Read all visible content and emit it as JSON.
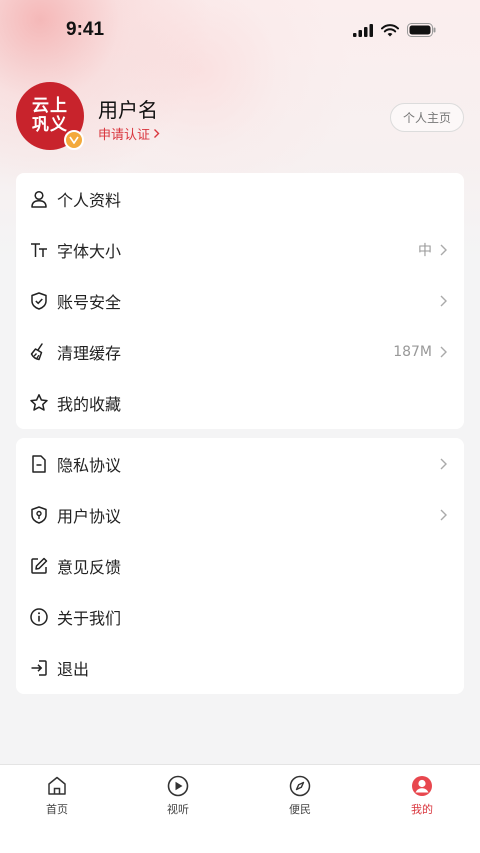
{
  "status_bar": {
    "time": "9:41"
  },
  "profile": {
    "avatar_text": "云上\n巩义",
    "username": "用户名",
    "verify_label": "申请认证",
    "homepage_button": "个人主页"
  },
  "menu_group_1": [
    {
      "label": "个人资料",
      "icon": "person-icon",
      "value": "",
      "chevron": false
    },
    {
      "label": "字体大小",
      "icon": "font-size-icon",
      "value": "中",
      "chevron": true
    },
    {
      "label": "账号安全",
      "icon": "shield-check-icon",
      "value": "",
      "chevron": true
    },
    {
      "label": "清理缓存",
      "icon": "broom-icon",
      "value": "187M",
      "chevron": true
    },
    {
      "label": "我的收藏",
      "icon": "star-icon",
      "value": "",
      "chevron": false
    }
  ],
  "menu_group_2": [
    {
      "label": "隐私协议",
      "icon": "document-icon",
      "value": "",
      "chevron": true
    },
    {
      "label": "用户协议",
      "icon": "shield-user-icon",
      "value": "",
      "chevron": true
    },
    {
      "label": "意见反馈",
      "icon": "edit-icon",
      "value": "",
      "chevron": false
    },
    {
      "label": "关于我们",
      "icon": "info-icon",
      "value": "",
      "chevron": false
    },
    {
      "label": "退出",
      "icon": "logout-icon",
      "value": "",
      "chevron": false
    }
  ],
  "tabbar": [
    {
      "label": "首页",
      "icon": "home-icon",
      "active": false
    },
    {
      "label": "视听",
      "icon": "play-icon",
      "active": false
    },
    {
      "label": "便民",
      "icon": "compass-icon",
      "active": false
    },
    {
      "label": "我的",
      "icon": "user-icon",
      "active": true
    }
  ],
  "colors": {
    "accent": "#d9363e",
    "avatar_bg": "#c8232c",
    "badge": "#f3a93c",
    "background": "#f4f4f5"
  }
}
